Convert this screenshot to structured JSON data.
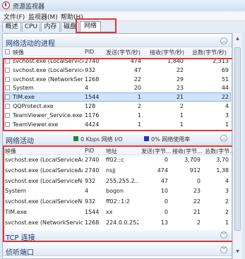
{
  "window": {
    "title": "资源监视器"
  },
  "menu": [
    "文件(F)",
    "监视器(M)",
    "帮助(H)"
  ],
  "tabs": [
    "概述",
    "CPU",
    "内存",
    "磁盘",
    "网络"
  ],
  "processes_section": {
    "title": "网络活动的进程",
    "columns": [
      "映像",
      "PID",
      "发送(字节/秒)",
      "接收(字节/秒)",
      "总数(字节/秒)"
    ],
    "rows": [
      {
        "name": "svchost.exe (LocalServiceA...",
        "pid": "2740",
        "send": "474",
        "recv": "1,840",
        "total": "2,313"
      },
      {
        "name": "svchost.exe (LocalServiceN...",
        "pid": "932",
        "send": "47",
        "recv": "22",
        "total": "69"
      },
      {
        "name": "svchost.exe (NetworkService)",
        "pid": "1268",
        "send": "22",
        "recv": "29",
        "total": "51"
      },
      {
        "name": "System",
        "pid": "4",
        "send": "20",
        "recv": "23",
        "total": "44"
      },
      {
        "name": "TIM.exe",
        "pid": "1544",
        "send": "1",
        "recv": "21",
        "total": "22"
      },
      {
        "name": "QQProtect.exe",
        "pid": "128",
        "send": "2",
        "recv": "2",
        "total": "4"
      },
      {
        "name": "TeamViewer_Service.exe",
        "pid": "1176",
        "send": "1",
        "recv": "1",
        "total": "3"
      },
      {
        "name": "TeamViewer.exe",
        "pid": "4424",
        "send": "1",
        "recv": "1",
        "total": "1"
      }
    ]
  },
  "network_section": {
    "title": "网络活动",
    "io_label": "0 Kbps 网络 I/O",
    "usage_label": "0% 网络使用率",
    "io_color": "#1e8c2e",
    "usage_color": "#2233c0",
    "columns": [
      "映像",
      "PID",
      "地址",
      "发送(字节...",
      "接收(字节...",
      "总数(字节..."
    ],
    "rows": [
      {
        "name": "svchost.exe (LocalServiceAnd...",
        "pid": "2740",
        "addr": "ff02::c",
        "send": "0",
        "recv": "3,709",
        "total": "3,70"
      },
      {
        "name": "svchost.exe (LocalServiceAnd...",
        "pid": "2740",
        "addr": "nsjj",
        "send": "474",
        "recv": "912",
        "total": "1,38"
      },
      {
        "name": "svchost.exe (LocalServiceNetw...",
        "pid": "932",
        "addr": "255.255.2...",
        "send": "47",
        "recv": "0",
        "total": "4"
      },
      {
        "name": "System",
        "pid": "4",
        "addr": "bogon",
        "send": "10",
        "recv": "23",
        "total": "3"
      },
      {
        "name": "svchost.exe (LocalServiceNe...",
        "pid": "932",
        "addr": "ff02::1:2",
        "send": "0",
        "recv": "22",
        "total": "2"
      },
      {
        "name": "TIM.exe",
        "pid": "1544",
        "addr": "xx",
        "send": "0",
        "recv": "21",
        "total": "2"
      },
      {
        "name": "svchost.exe (NetworkService)",
        "pid": "1268",
        "addr": "224.0.0.252",
        "send": "13",
        "recv": "2",
        "total": "1"
      }
    ]
  },
  "tcp_section": {
    "title": "TCP 连接"
  },
  "listen_section": {
    "title": "侦听端口"
  }
}
